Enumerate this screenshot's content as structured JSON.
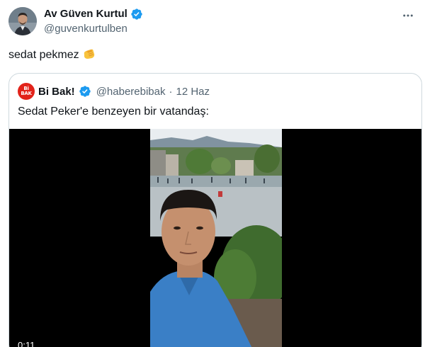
{
  "author": {
    "display_name": "Av Güven Kurtul",
    "handle": "@guvenkurtulben",
    "verified_icon": "verified-badge-icon"
  },
  "tweet": {
    "text": "sedat pekmez",
    "emoji": "pinched-fingers-hand-emoji"
  },
  "more_icon": "more-horizontal-icon",
  "quote": {
    "avatar_text_line1": "Bi",
    "avatar_text_line2": "BAK",
    "display_name": "Bi Bak!",
    "handle": "@haberebibak",
    "separator": "·",
    "date": "12 Haz",
    "text": "Sedat Peker'e benzeyen bir vatandaş:",
    "video": {
      "timestamp": "0:11"
    }
  },
  "colors": {
    "text": "#0f1419",
    "secondary_text": "#536471",
    "verified_blue": "#1d9bf0",
    "border": "#cfd9de",
    "bibak_red": "#e2231a",
    "video_background": "#000000"
  }
}
